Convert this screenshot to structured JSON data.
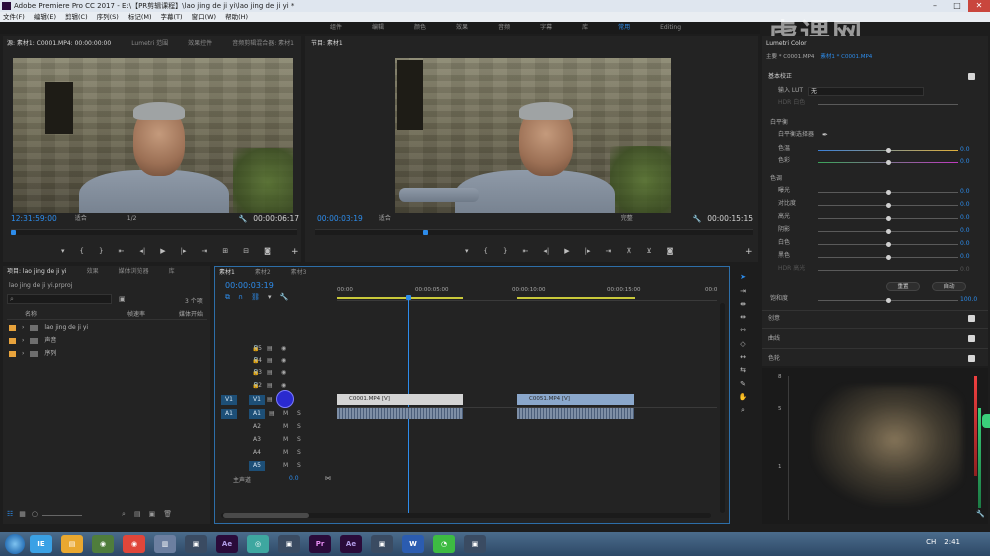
{
  "window": {
    "title": "Adobe Premiere Pro CC 2017 - E:\\【PR剪辑课程】\\lao jing de ji yi\\lao jing de ji yi *"
  },
  "menu": [
    "文件(F)",
    "编辑(E)",
    "剪辑(C)",
    "序列(S)",
    "标记(M)",
    "字幕(T)",
    "窗口(W)",
    "帮助(H)"
  ],
  "workspaces": {
    "items": [
      "组件",
      "编辑",
      "颜色",
      "效果",
      "音频",
      "字幕",
      "库",
      "常用",
      "Editing"
    ],
    "active_index": 7
  },
  "watermark": "虎课网",
  "source_monitor": {
    "tabs": [
      "源: 素材1: C0001.MP4: 00:00:00:00",
      "Lumetri 范围",
      "效果控件",
      "音频剪辑混合器: 素材1"
    ],
    "timecode_left": "12:31:59:00",
    "fit": "适合",
    "resolution": "1/2",
    "timecode_right": "00:00:06:17"
  },
  "program_monitor": {
    "tab": "节目: 素材1",
    "timecode_left": "00:00:03:19",
    "fit": "适合",
    "resolution": "完整",
    "timecode_right": "00:00:15:15"
  },
  "project_panel": {
    "tabs": [
      "项目: lao jing de ji yi",
      "效果",
      "媒体浏览器",
      "库"
    ],
    "file": "lao jing de ji yi.prproj",
    "item_count": "3 个项",
    "columns": [
      "名称",
      "帧速率",
      "媒体开始"
    ],
    "items": [
      "lao jing de ji yi",
      "声音",
      "序列"
    ]
  },
  "timeline": {
    "tabs": [
      "素材1",
      "素材2",
      "素材3"
    ],
    "timecode": "00:00:03:19",
    "ruler": [
      "00:00",
      "00:00:05:00",
      "00:00:10:00",
      "00:00:15:00",
      "00:0"
    ],
    "video_tracks": [
      "V5",
      "V4",
      "V3",
      "V2",
      "V1"
    ],
    "audio_tracks": [
      "A1",
      "A2",
      "A3",
      "A4",
      "A5"
    ],
    "source_v": "V1",
    "source_a": "A1",
    "track_m": "M",
    "track_s": "S",
    "master_label": "主声道",
    "master_value": "0.0",
    "clips": [
      {
        "name": "C0001.MP4 [V]"
      },
      {
        "name": "C0051.MP4 [V]"
      }
    ]
  },
  "lumetri": {
    "tab": "Lumetri Color",
    "clip": "主要 * C0001.MP4",
    "clip_seq": "素材1 * C0001.MP4",
    "section_basic": "基本校正",
    "input_lut_label": "输入 LUT",
    "input_lut_value": "无",
    "hdr_white": "HDR 白色",
    "wb_section": "白平衡",
    "wb_selector": "白平衡选择器",
    "temperature": "色温",
    "tint": "色彩",
    "tone_section": "色调",
    "tone_rows": [
      "曝光",
      "对比度",
      "高光",
      "阴影",
      "白色",
      "黑色",
      "HDR 高光"
    ],
    "zero": "0.0",
    "buttons": [
      "重置",
      "自动"
    ],
    "saturation": "饱和度",
    "saturation_value": "100.0",
    "sections": [
      "创意",
      "曲线",
      "色轮"
    ],
    "scope_labels": [
      "8",
      "5",
      "1"
    ]
  },
  "taskbar": {
    "apps": [
      "IE",
      "Ae",
      "Pr",
      "Ae",
      "W"
    ],
    "tray": [
      "CH",
      "2:41"
    ]
  },
  "colors": {
    "accent": "#2d8ceb",
    "clip_audio": "#7e8fa6",
    "clip_video": "#d4d4d4",
    "clip_video_2": "#8aa7cb",
    "folder": "#e8a33c",
    "track_blue": "#1d4f77"
  }
}
